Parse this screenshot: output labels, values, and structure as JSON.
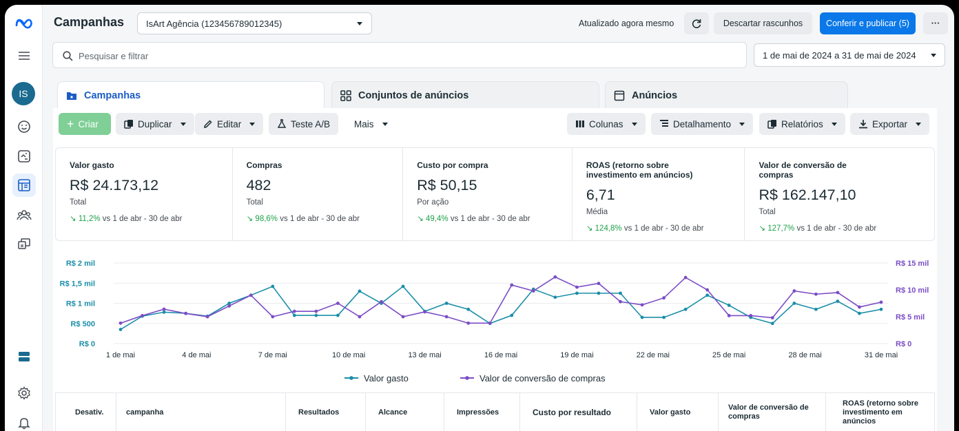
{
  "header": {
    "title": "Campanhas",
    "account": "IsArt Agência (123456789012345)",
    "updated": "Atualizado agora mesmo",
    "discard": "Descartar rascunhos",
    "publish": "Conferir e publicar (5)",
    "more": "···"
  },
  "rail": {
    "avatar": "IS"
  },
  "search": {
    "placeholder": "Pesquisar e filtrar"
  },
  "date_range": "1 de mai de 2024 a 31 de mai de 2024",
  "tabs": [
    {
      "label": "Campanhas"
    },
    {
      "label": "Conjuntos de anúncios"
    },
    {
      "label": "Anúncios"
    }
  ],
  "toolbar": {
    "create": "Criar",
    "duplicate": "Duplicar",
    "edit": "Editar",
    "ab_test": "Teste A/B",
    "more": "Mais",
    "columns": "Colunas",
    "breakdown": "Detalhamento",
    "reports": "Relatórios",
    "export": "Exportar"
  },
  "metrics": [
    {
      "label": "Valor gasto",
      "value": "R$ 24.173,12",
      "sub": "Total",
      "delta": "↘ 11,2%",
      "compare": "vs 1 de abr - 30 de abr"
    },
    {
      "label": "Compras",
      "value": "482",
      "sub": "Total",
      "delta": "↘ 98,6%",
      "compare": "vs 1 de abr - 30 de abr"
    },
    {
      "label": "Custo por compra",
      "value": "R$ 50,15",
      "sub": "Por ação",
      "delta": "↘ 49,4%",
      "compare": "vs 1 de abr - 30 de abr"
    },
    {
      "label": "ROAS (retorno sobre investimento em anúncios)",
      "value": "6,71",
      "sub": "Média",
      "delta": "↘ 124,8%",
      "compare": "vs 1 de abr - 30 de abr"
    },
    {
      "label": "Valor de conversão de compras",
      "value": "R$ 162.147,10",
      "sub": "Total",
      "delta": "↘ 127,7%",
      "compare": "vs 1 de abr - 30 de abr"
    }
  ],
  "colors": {
    "spend": "#1a8ea8",
    "conversion": "#7b4cc6",
    "accent": "#0a78e8",
    "positive": "#1fa24a"
  },
  "chart_data": {
    "type": "line",
    "x": [
      "1 de mai",
      "2 de mai",
      "3 de mai",
      "4 de mai",
      "5 de mai",
      "6 de mai",
      "7 de mai",
      "8 de mai",
      "9 de mai",
      "10 de mai",
      "11 de mai",
      "12 de mai",
      "13 de mai",
      "14 de mai",
      "15 de mai",
      "16 de mai",
      "17 de mai",
      "18 de mai",
      "19 de mai",
      "20 de mai",
      "21 de mai",
      "22 de mai",
      "23 de mai",
      "24 de mai",
      "25 de mai",
      "26 de mai",
      "27 de mai",
      "28 de mai",
      "29 de mai",
      "30 de mai",
      "31 de mai",
      "1 de jun"
    ],
    "x_tick_labels": [
      "1 de mai",
      "4 de mai",
      "7 de mai",
      "10 de mai",
      "13 de mai",
      "16 de mai",
      "19 de mai",
      "22 de mai",
      "25 de mai",
      "28 de mai",
      "31 de mai"
    ],
    "left_axis": {
      "ticks": [
        "R$ 0",
        "R$ 500",
        "R$ 1 mil",
        "R$ 1,5 mil",
        "R$ 2 mil"
      ],
      "ylim": [
        0,
        2000
      ]
    },
    "right_axis": {
      "ticks": [
        "R$ 0",
        "R$ 5 mil",
        "R$ 10 mil",
        "R$ 15 mil"
      ],
      "ylim": [
        0,
        15000
      ]
    },
    "series": [
      {
        "name": "Valor gasto",
        "axis": "left",
        "values": [
          350,
          680,
          780,
          750,
          680,
          1000,
          1200,
          1420,
          700,
          700,
          700,
          1300,
          1000,
          1420,
          800,
          1000,
          850,
          500,
          700,
          1350,
          1150,
          1250,
          1250,
          1250,
          650,
          650,
          850,
          1200,
          950,
          650,
          500,
          1000,
          850,
          1050,
          750,
          850
        ]
      },
      {
        "name": "Valor de conversão de compras",
        "axis": "right",
        "values": [
          3800,
          5200,
          6400,
          5600,
          5000,
          7000,
          9000,
          5000,
          6000,
          6000,
          7500,
          5000,
          7800,
          5000,
          5900,
          5000,
          3800,
          3800,
          10900,
          9800,
          12400,
          10500,
          11200,
          7800,
          7200,
          8500,
          12300,
          10000,
          5200,
          5200,
          4800,
          9800,
          9200,
          9500,
          6800,
          7700
        ]
      }
    ],
    "legend": {
      "placement": "bottom-center"
    },
    "grid": true
  },
  "table": {
    "columns": [
      "Desativ.",
      "campanha",
      "Resultados",
      "Alcance",
      "Impressões",
      "Custo por resultado",
      "Valor gasto",
      "Valor de conversão de compras",
      "ROAS (retorno sobre investimento em anúncios"
    ]
  }
}
